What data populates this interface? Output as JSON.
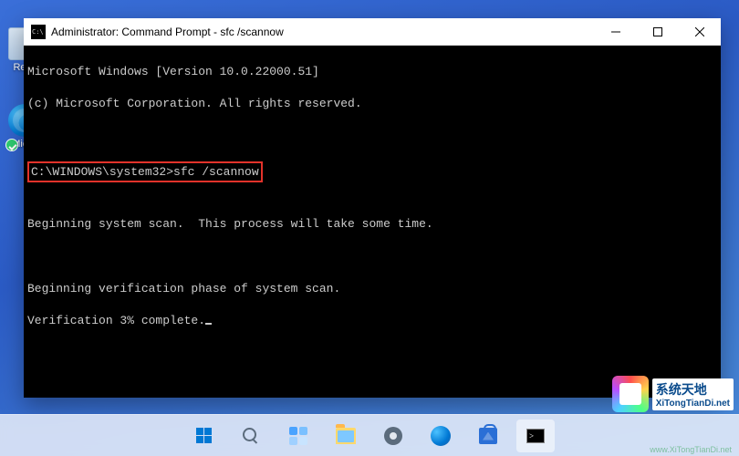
{
  "desktop": {
    "recycle_bin_label": "Recy",
    "edge_label": "Mic\nE"
  },
  "window": {
    "title": "Administrator: Command Prompt - sfc  /scannow"
  },
  "terminal": {
    "line1": "Microsoft Windows [Version 10.0.22000.51]",
    "line2": "(c) Microsoft Corporation. All rights reserved.",
    "prompt": "C:\\WINDOWS\\system32>",
    "command": "sfc /scannow",
    "line3": "Beginning system scan.  This process will take some time.",
    "line4": "Beginning verification phase of system scan.",
    "line5": "Verification 3% complete."
  },
  "watermark": {
    "brand_cn": "系统天地",
    "brand_en": "XiTongTianDi.net",
    "url": "www.XiTongTianDi.net"
  }
}
